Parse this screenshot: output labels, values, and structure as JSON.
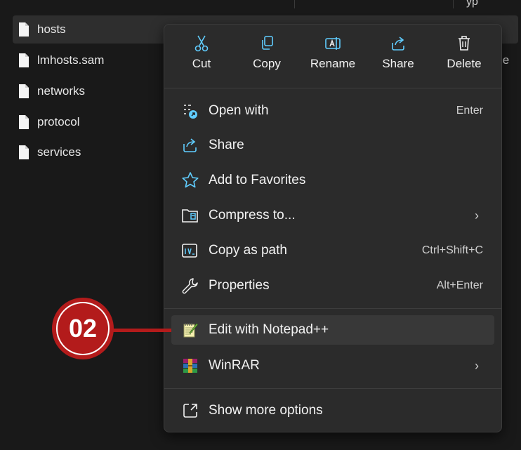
{
  "header": {
    "fragment": "yp"
  },
  "background_fragment": "le",
  "files": [
    {
      "name": "hosts",
      "selected": true
    },
    {
      "name": "lmhosts.sam",
      "selected": false
    },
    {
      "name": "networks",
      "selected": false
    },
    {
      "name": "protocol",
      "selected": false
    },
    {
      "name": "services",
      "selected": false
    }
  ],
  "menu": {
    "actions": [
      {
        "label": "Cut",
        "icon": "scissors-icon"
      },
      {
        "label": "Copy",
        "icon": "copy-icon"
      },
      {
        "label": "Rename",
        "icon": "rename-icon"
      },
      {
        "label": "Share",
        "icon": "share-icon"
      },
      {
        "label": "Delete",
        "icon": "trash-icon"
      }
    ],
    "items": [
      {
        "label": "Open with",
        "shortcut": "Enter",
        "icon": "open-with-icon"
      },
      {
        "label": "Share",
        "shortcut": "",
        "icon": "share-icon"
      },
      {
        "label": "Add to Favorites",
        "shortcut": "",
        "icon": "star-icon"
      },
      {
        "label": "Compress to...",
        "shortcut": "",
        "icon": "zip-folder-icon",
        "submenu": true
      },
      {
        "label": "Copy as path",
        "shortcut": "Ctrl+Shift+C",
        "icon": "path-icon"
      },
      {
        "label": "Properties",
        "shortcut": "Alt+Enter",
        "icon": "wrench-icon"
      },
      {
        "label": "Edit with Notepad++",
        "shortcut": "",
        "icon": "notepadpp-icon",
        "highlighted": true
      },
      {
        "label": "WinRAR",
        "shortcut": "",
        "icon": "winrar-icon",
        "submenu": true
      },
      {
        "label": "Show more options",
        "shortcut": "",
        "icon": "show-more-icon"
      }
    ]
  },
  "callout": {
    "number": "02"
  },
  "colors": {
    "accent_blue": "#60cdff",
    "callout_red": "#b31b1b",
    "menu_bg": "#2b2b2b"
  }
}
